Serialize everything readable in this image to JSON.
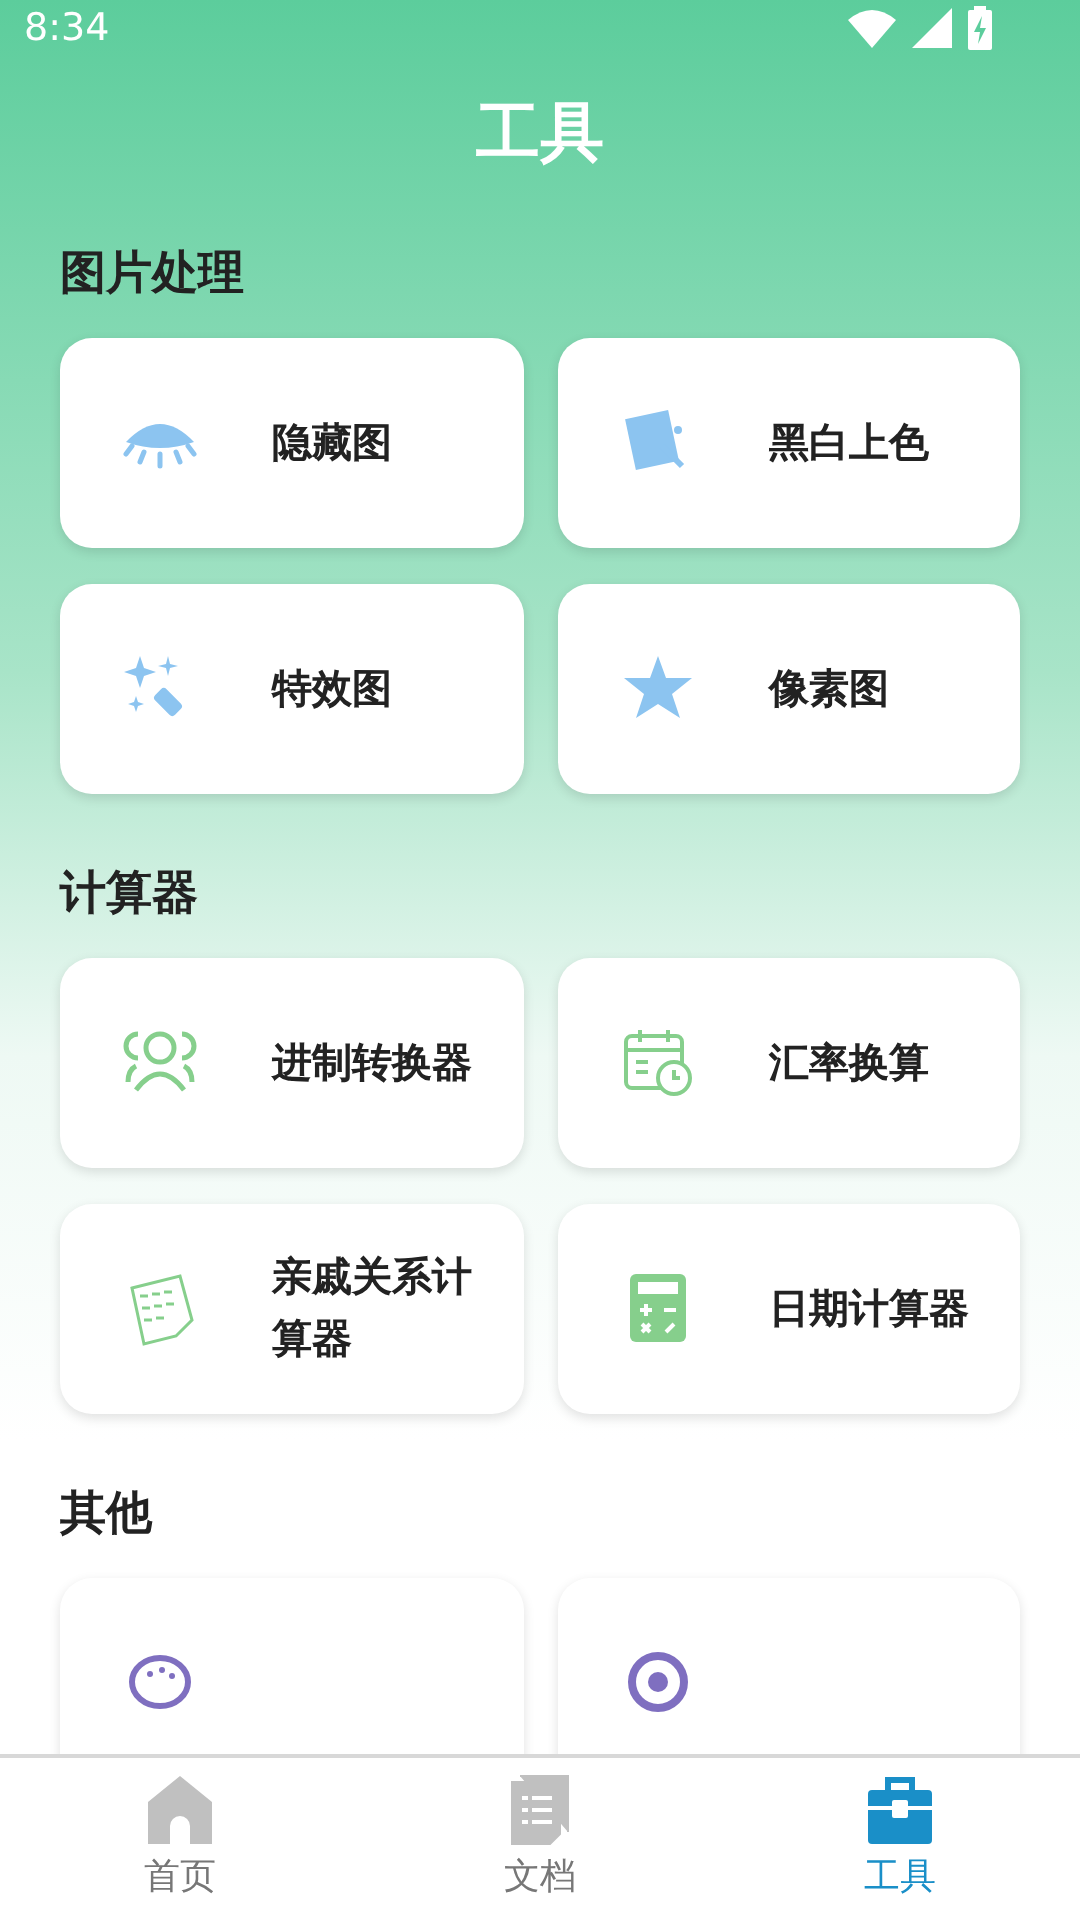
{
  "status_bar": {
    "time": "8:34"
  },
  "title": "工具",
  "sections": [
    {
      "title": "图片处理",
      "items": [
        {
          "kind": "tool",
          "label": "隐藏图"
        },
        {
          "kind": "tool",
          "label": "黑白上色"
        },
        {
          "kind": "tool",
          "label": "特效图"
        },
        {
          "kind": "tool",
          "label": "像素图"
        }
      ]
    },
    {
      "title": "计算器",
      "items": [
        {
          "kind": "tool",
          "label": "进制转换器"
        },
        {
          "kind": "tool",
          "label": "汇率换算"
        },
        {
          "kind": "tool",
          "label": "亲戚关系计算器"
        },
        {
          "kind": "tool",
          "label": "日期计算器"
        }
      ]
    },
    {
      "title": "其他",
      "items": [
        {
          "kind": "cut"
        },
        {
          "kind": "cut"
        }
      ]
    }
  ],
  "tabs": [
    {
      "label": "首页",
      "selected": false
    },
    {
      "label": "文档",
      "selected": false
    },
    {
      "label": "工具",
      "selected": true
    }
  ]
}
